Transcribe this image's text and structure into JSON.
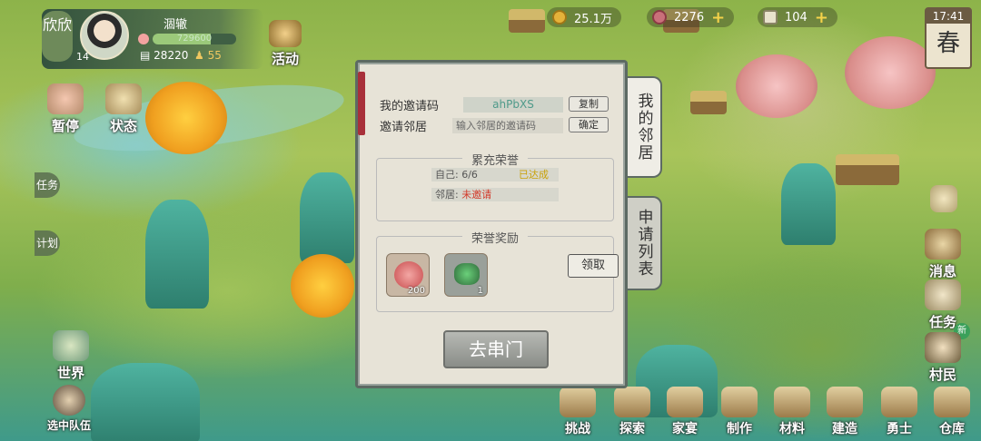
{
  "player": {
    "short_name": "欣欣",
    "level": "14",
    "name": "涸辙",
    "hp_text": "729600",
    "hp_fill": 0.7,
    "coins": "28220",
    "population": "55"
  },
  "resources": {
    "copper": "25.1万",
    "meat": "2276",
    "tickets": "104"
  },
  "clock": {
    "time": "17:41",
    "season": "春"
  },
  "left_buttons": {
    "pause": "暂停",
    "status": "状态",
    "activity": "活动",
    "world": "世界",
    "team": "选中队伍"
  },
  "left_tabs": {
    "task": "任务",
    "plan": "计划"
  },
  "right_buttons": {
    "message": "消息",
    "task": "任务",
    "new_badge": "新",
    "villager": "村民"
  },
  "bottom_bar": [
    "挑战",
    "探索",
    "家宴",
    "制作",
    "材料",
    "建造",
    "勇士",
    "仓库"
  ],
  "modal": {
    "my_code_label": "我的邀请码",
    "my_code": "ahPbXS",
    "copy_btn": "复制",
    "invite_label": "邀请邻居",
    "invite_placeholder": "输入邻居的邀请码",
    "confirm_btn": "确定",
    "honor_title": "累充荣誉",
    "self_line": "自己: 6/6",
    "self_status": "已达成",
    "neighbor_line": "邻居: ",
    "neighbor_status": "未邀请",
    "reward_title": "荣誉奖励",
    "reward1_count": "200",
    "reward2_count": "1",
    "claim_btn": "领取",
    "go_btn": "去串门"
  },
  "side_tabs": {
    "neighbors": "我的邻居",
    "requests": "申请列表"
  },
  "colors": {
    "accent_green": "#4f9a8a",
    "warn_red": "#d23a2a",
    "ok_yellow": "#c9a20b"
  }
}
